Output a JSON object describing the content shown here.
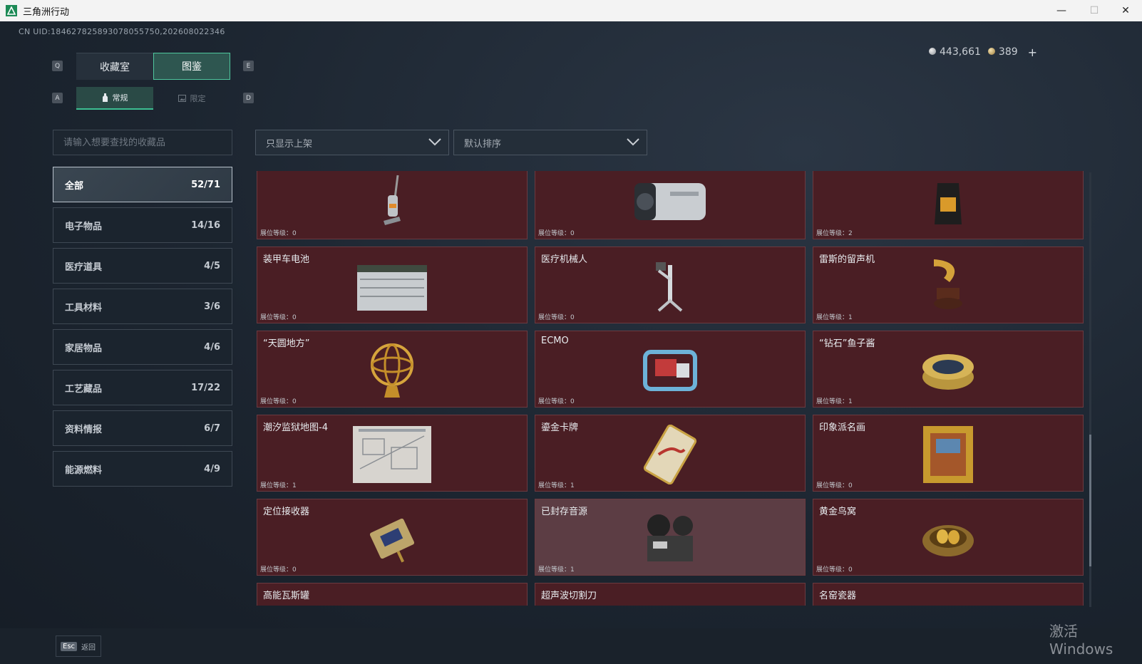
{
  "window": {
    "title": "三角洲行动",
    "minimize": "—",
    "maximize": "☐",
    "close": "✕"
  },
  "uid": "CN UID:184627825893078055750,202608022346",
  "currency": {
    "silver": "443,661",
    "gold": "389",
    "plus": "+"
  },
  "tabs": {
    "key_left": "Q",
    "key_right": "E",
    "items": [
      {
        "label": "收藏室"
      },
      {
        "label": "图鉴"
      }
    ]
  },
  "subtabs": {
    "key_left": "A",
    "key_right": "D",
    "items": [
      {
        "label": "常规"
      },
      {
        "label": "限定"
      }
    ]
  },
  "search": {
    "placeholder": "请输入想要查找的收藏品"
  },
  "filters": {
    "shelf": "只显示上架",
    "sort": "默认排序"
  },
  "categories": [
    {
      "label": "全部",
      "count": "52/71"
    },
    {
      "label": "电子物品",
      "count": "14/16"
    },
    {
      "label": "医疗道具",
      "count": "4/5"
    },
    {
      "label": "工具材料",
      "count": "3/6"
    },
    {
      "label": "家居物品",
      "count": "4/6"
    },
    {
      "label": "工艺藏品",
      "count": "17/22"
    },
    {
      "label": "资料情报",
      "count": "6/7"
    },
    {
      "label": "能源燃料",
      "count": "4/9"
    }
  ],
  "level_prefix": "展位等级：",
  "items": [
    {
      "name": "",
      "level": "0",
      "icon": "vacuum-icon"
    },
    {
      "name": "",
      "level": "0",
      "icon": "projector-icon"
    },
    {
      "name": "",
      "level": "2",
      "icon": "coffee-bag-icon"
    },
    {
      "name": "装甲车电池",
      "level": "0",
      "icon": "battery-icon"
    },
    {
      "name": "医疗机械人",
      "level": "0",
      "icon": "medical-robot-icon"
    },
    {
      "name": "雷斯的留声机",
      "level": "1",
      "icon": "gramophone-icon"
    },
    {
      "name": "“天圆地方”",
      "level": "0",
      "icon": "armillary-icon"
    },
    {
      "name": "ECMO",
      "level": "0",
      "icon": "ecmo-icon"
    },
    {
      "name": "“钻石”鱼子酱",
      "level": "1",
      "icon": "caviar-icon"
    },
    {
      "name": "潮汐监狱地图-4",
      "level": "1",
      "icon": "map-icon"
    },
    {
      "name": "鎏金卡牌",
      "level": "1",
      "icon": "card-icon"
    },
    {
      "name": "印象派名画",
      "level": "0",
      "icon": "painting-icon"
    },
    {
      "name": "定位接收器",
      "level": "0",
      "icon": "receiver-icon"
    },
    {
      "name": "已封存音源",
      "level": "1",
      "icon": "tape-recorder-icon"
    },
    {
      "name": "黄金鸟窝",
      "level": "0",
      "icon": "nest-icon"
    },
    {
      "name": "高能瓦斯罐",
      "level": "",
      "icon": "gas-can-icon"
    },
    {
      "name": "超声波切割刀",
      "level": "",
      "icon": "cutter-icon"
    },
    {
      "name": "名窑瓷器",
      "level": "",
      "icon": "porcelain-icon"
    }
  ],
  "footer": {
    "esc_key": "Esc",
    "back": "返回"
  },
  "watermark": "激活 Windows",
  "colors": {
    "accent": "#3cbf92",
    "card_bg": "#4a1e24",
    "card_highlight": "#5c3d44"
  }
}
